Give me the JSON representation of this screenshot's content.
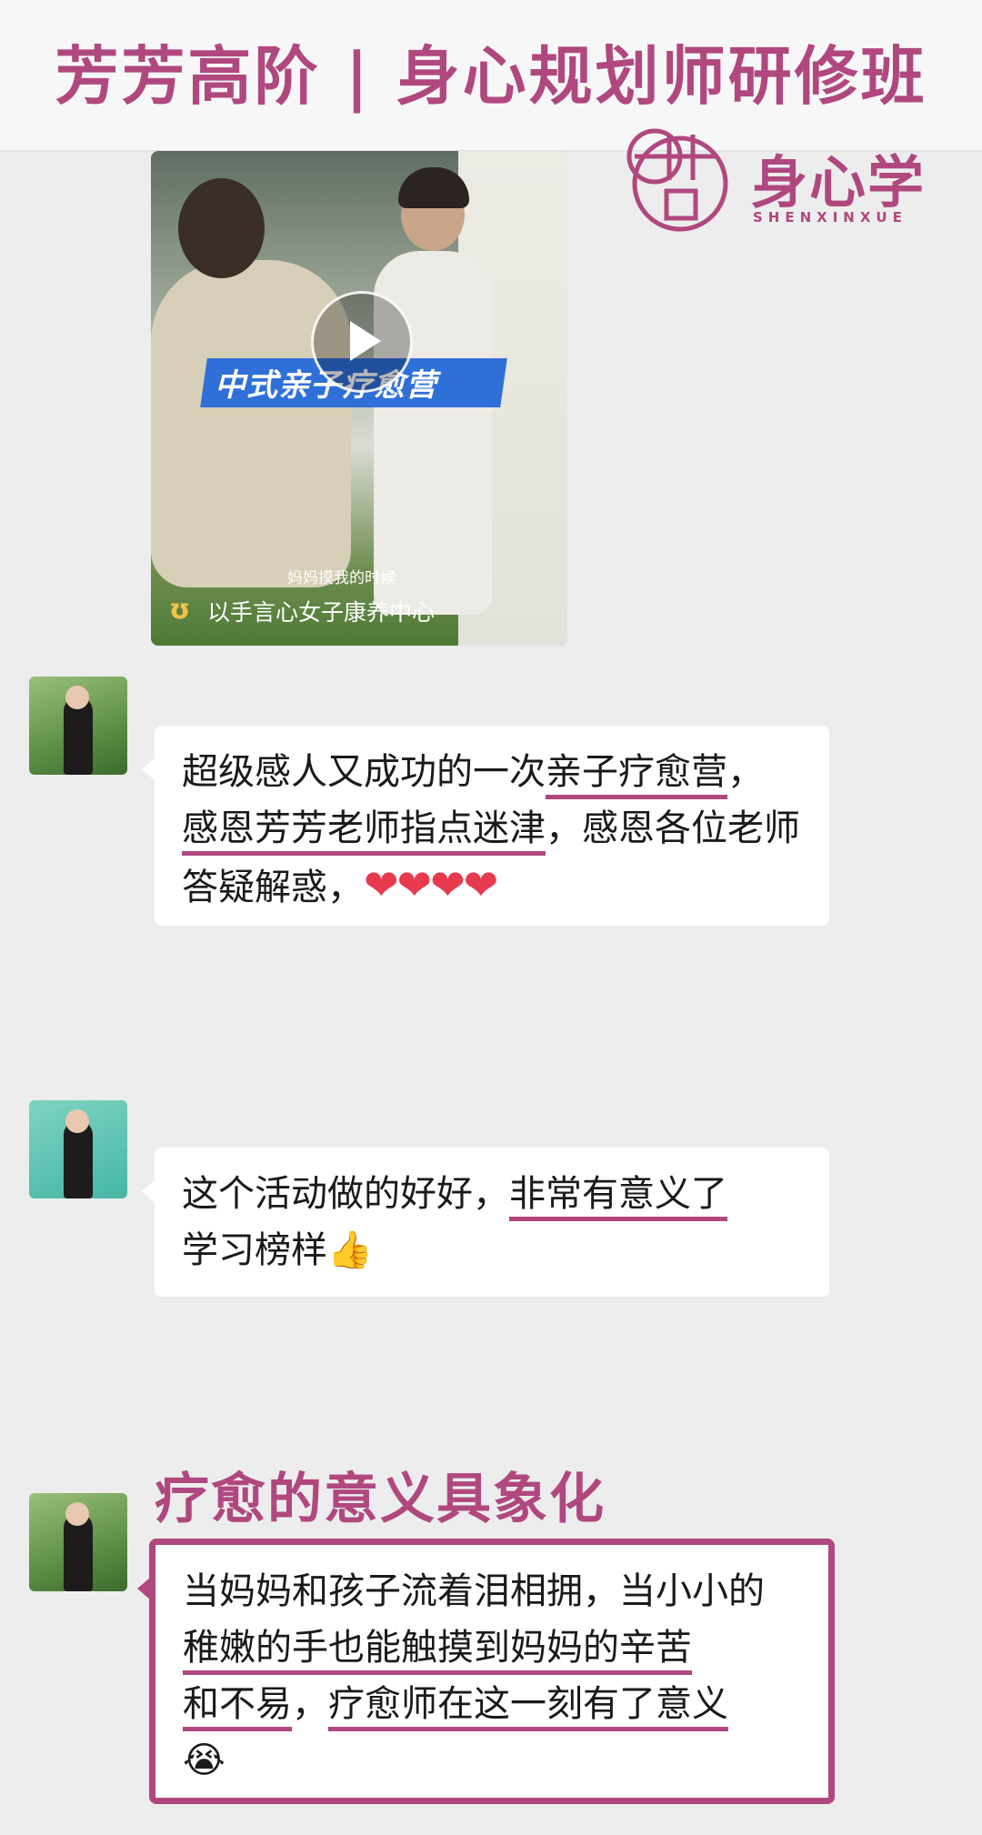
{
  "header": {
    "title": "芳芳高阶 | 身心规划师研修班",
    "logo_text": "身心学",
    "logo_sub": "SHENXINXUE"
  },
  "video": {
    "banner": "中式亲子疗愈营",
    "subtitle": "妈妈摸我的时候",
    "channel": "以手言心女子康养中心"
  },
  "messages": [
    {
      "segments": [
        "超级感人又成功的一次",
        "亲子疗愈营",
        "，",
        "感恩芳芳老师指点迷津",
        "，感恩各位老师答疑解惑，"
      ],
      "emoji": "❤❤❤❤"
    },
    {
      "segments": [
        "这个活动做的好好，",
        "非常有意义了",
        "学习榜样"
      ],
      "emoji": "👍"
    },
    {
      "segments": [
        "当妈妈和孩子流着泪相拥，当小小的",
        "稚嫩的手也能触摸到妈妈的辛苦",
        "和不易",
        "，",
        "疗愈师在这一刻有了意义"
      ],
      "emoji": "😭"
    }
  ],
  "heading2": "疗愈的意义具象化",
  "colors": {
    "brand": "#b0487f",
    "background": "#ededed"
  }
}
